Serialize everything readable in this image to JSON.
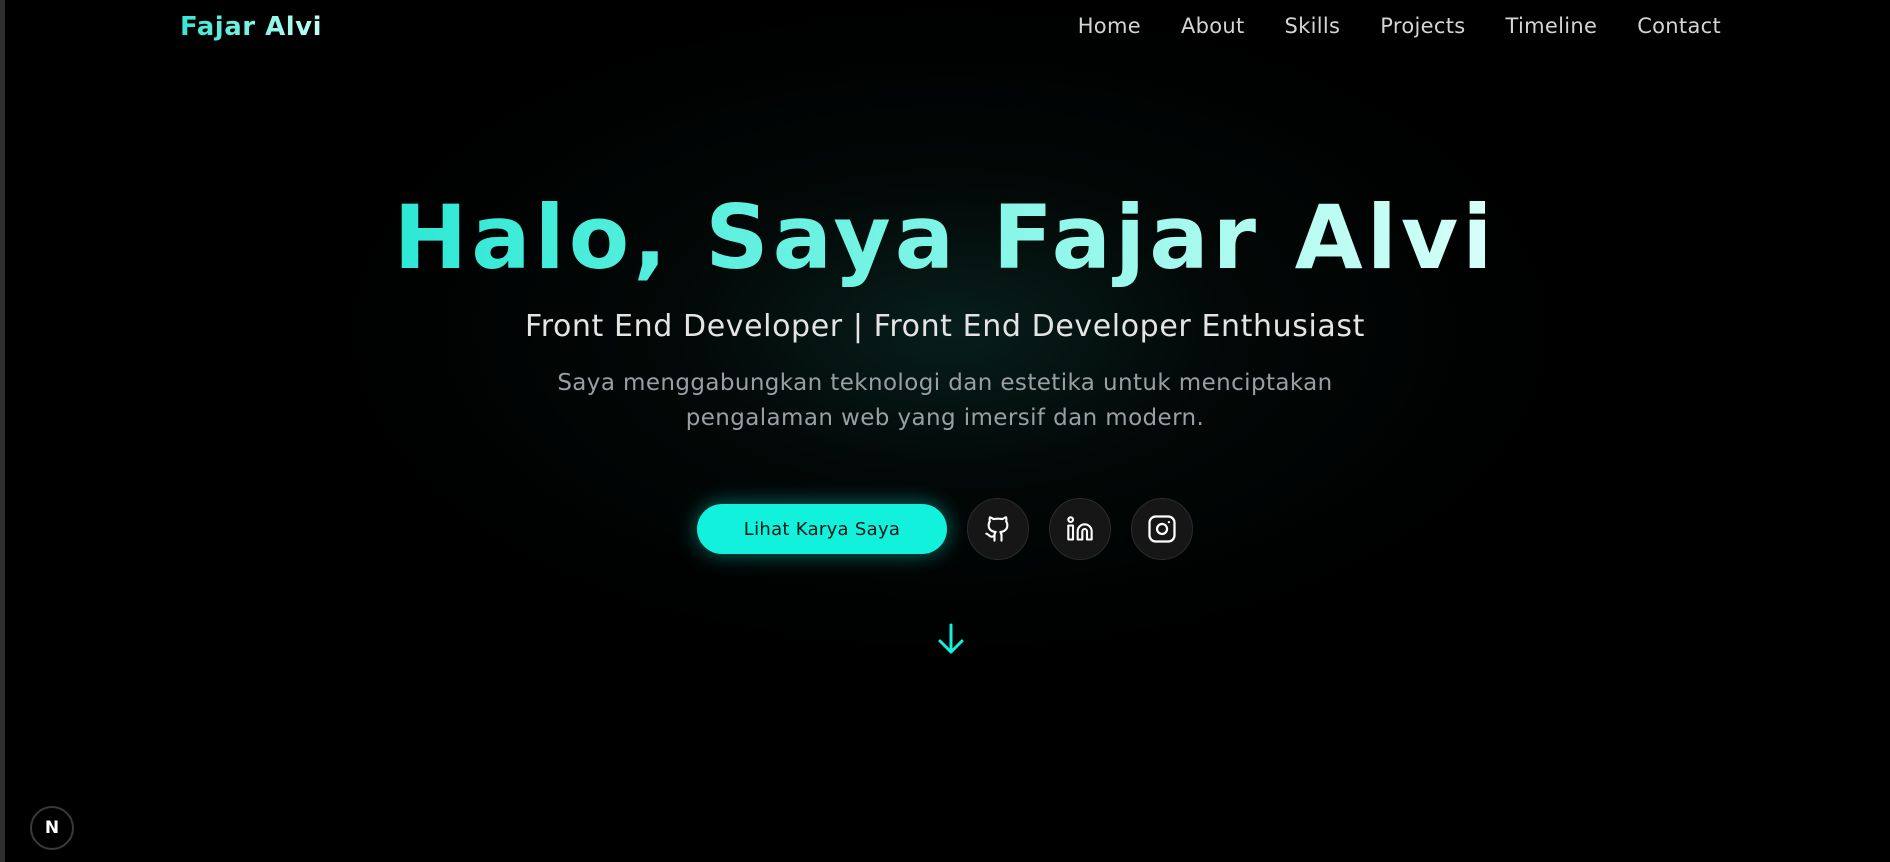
{
  "brand": "Fajar Alvi",
  "nav": {
    "links": [
      "Home",
      "About",
      "Skills",
      "Projects",
      "Timeline",
      "Contact"
    ]
  },
  "hero": {
    "title": "Halo, Saya Fajar Alvi",
    "subtitle": "Front End Developer | Front End Developer Enthusiast",
    "description": "Saya menggabungkan teknologi dan estetika untuk menciptakan pengalaman web yang imersif dan modern.",
    "cta_label": "Lihat Karya Saya"
  },
  "social": [
    {
      "icon": "github-icon"
    },
    {
      "icon": "linkedin-icon"
    },
    {
      "icon": "instagram-icon"
    }
  ],
  "scroll": {
    "icon": "arrow-down-icon"
  },
  "dev_badge": {
    "label": "N",
    "icon": "nextjs-icon"
  },
  "colors": {
    "background": "#000000",
    "accent": "#12f1dc",
    "title_gradient_start": "#2de8d5",
    "title_gradient_end": "#d6fff8",
    "text": "#e4e4e4",
    "muted_text": "#9a9fa3"
  }
}
